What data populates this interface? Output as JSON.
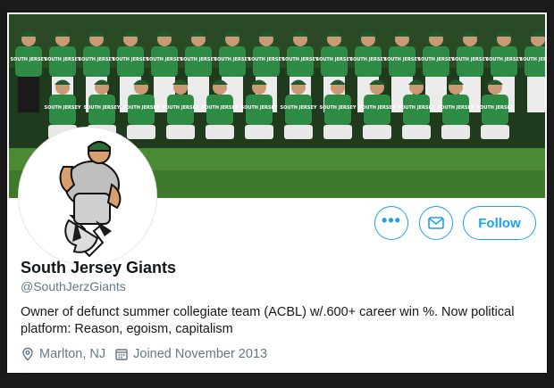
{
  "profile": {
    "name": "South Jersey Giants",
    "handle": "@SouthJerzGiants",
    "bio": "Owner of defunct summer collegiate team (ACBL) w/.600+ career win %. Now political platform: Reason, egoism, capitalism",
    "location": "Marlton, NJ",
    "joined": "Joined November 2013"
  },
  "buttons": {
    "more_label": "•••",
    "follow_label": "Follow"
  },
  "banner": {
    "jersey_text": "SOUTH JERSEY"
  },
  "colors": {
    "accent": "#1da1f2",
    "jersey_green": "#2e8b45",
    "grass": "#4a8a34",
    "trees": "#1f3a1c"
  },
  "icons": {
    "more": "more-icon",
    "message": "mail-icon",
    "location": "location-pin-icon",
    "calendar": "calendar-icon"
  }
}
